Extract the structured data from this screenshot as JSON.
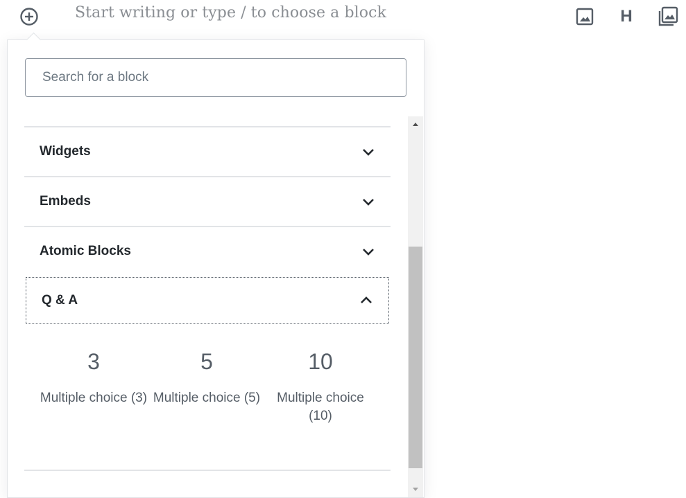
{
  "editor": {
    "placeholder": "Start writing or type / to choose a block",
    "quick_tools": {
      "image_icon": "image-icon",
      "heading_label": "H",
      "gallery_icon": "gallery-icon"
    },
    "inserter_icon": "plus-circle-icon"
  },
  "inserter": {
    "search_placeholder": "Search for a block",
    "panels": [
      {
        "title": "Widgets",
        "expanded": false
      },
      {
        "title": "Embeds",
        "expanded": false
      },
      {
        "title": "Atomic Blocks",
        "expanded": false
      },
      {
        "title": "Q & A",
        "expanded": true
      }
    ],
    "qa_items": [
      {
        "icon": "3",
        "label": "Multiple choice (3)"
      },
      {
        "icon": "5",
        "label": "Multiple choice (5)"
      },
      {
        "icon": "10",
        "label": "Multiple choice (10)"
      }
    ]
  },
  "colors": {
    "text": "#23282d",
    "muted": "#555d66",
    "border": "#e2e4e7",
    "scroll_thumb": "#c1c1c1"
  }
}
